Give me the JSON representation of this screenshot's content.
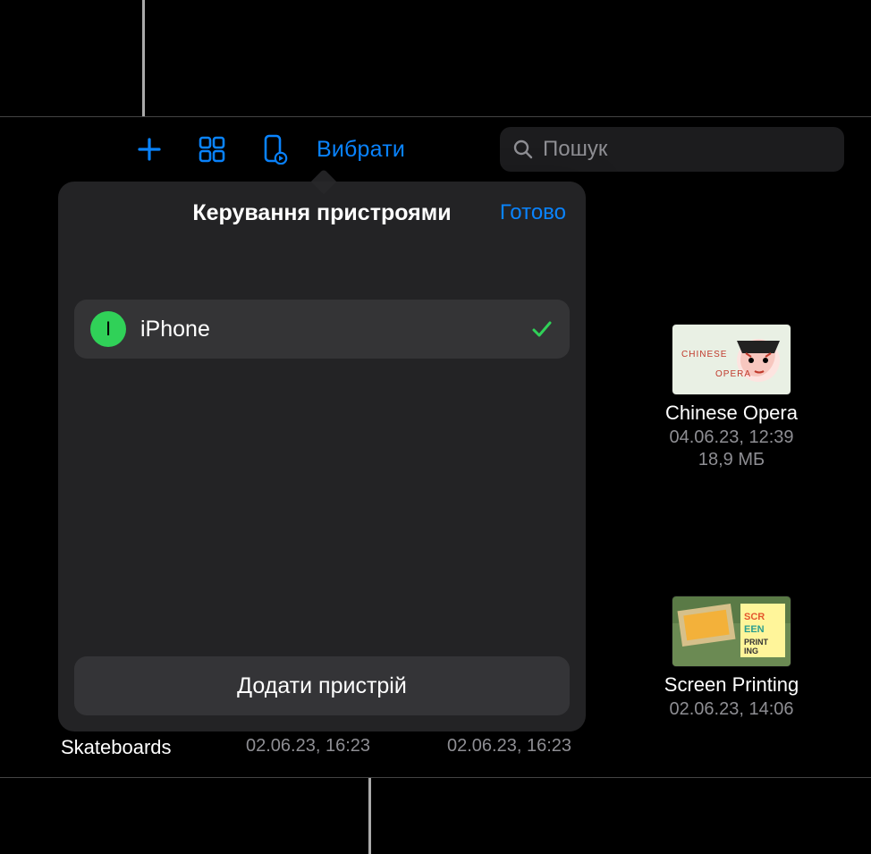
{
  "toolbar": {
    "select_label": "Вибрати"
  },
  "search": {
    "placeholder": "Пошук"
  },
  "popover": {
    "title": "Керування пристроями",
    "done_label": "Готово",
    "device": {
      "avatar_initial": "I",
      "name": "iPhone"
    },
    "add_label": "Додати пристрій"
  },
  "files": {
    "chinese_opera": {
      "title": "Chinese Opera",
      "sub": "04.06.23, 12:39\n18,9 МБ"
    },
    "screen_printing": {
      "title": "Screen Printing",
      "sub": "02.06.23, 14:06"
    }
  },
  "bottom": {
    "skateboards": "Skateboards",
    "date1": "02.06.23, 16:23",
    "date2": "02.06.23, 16:23"
  }
}
